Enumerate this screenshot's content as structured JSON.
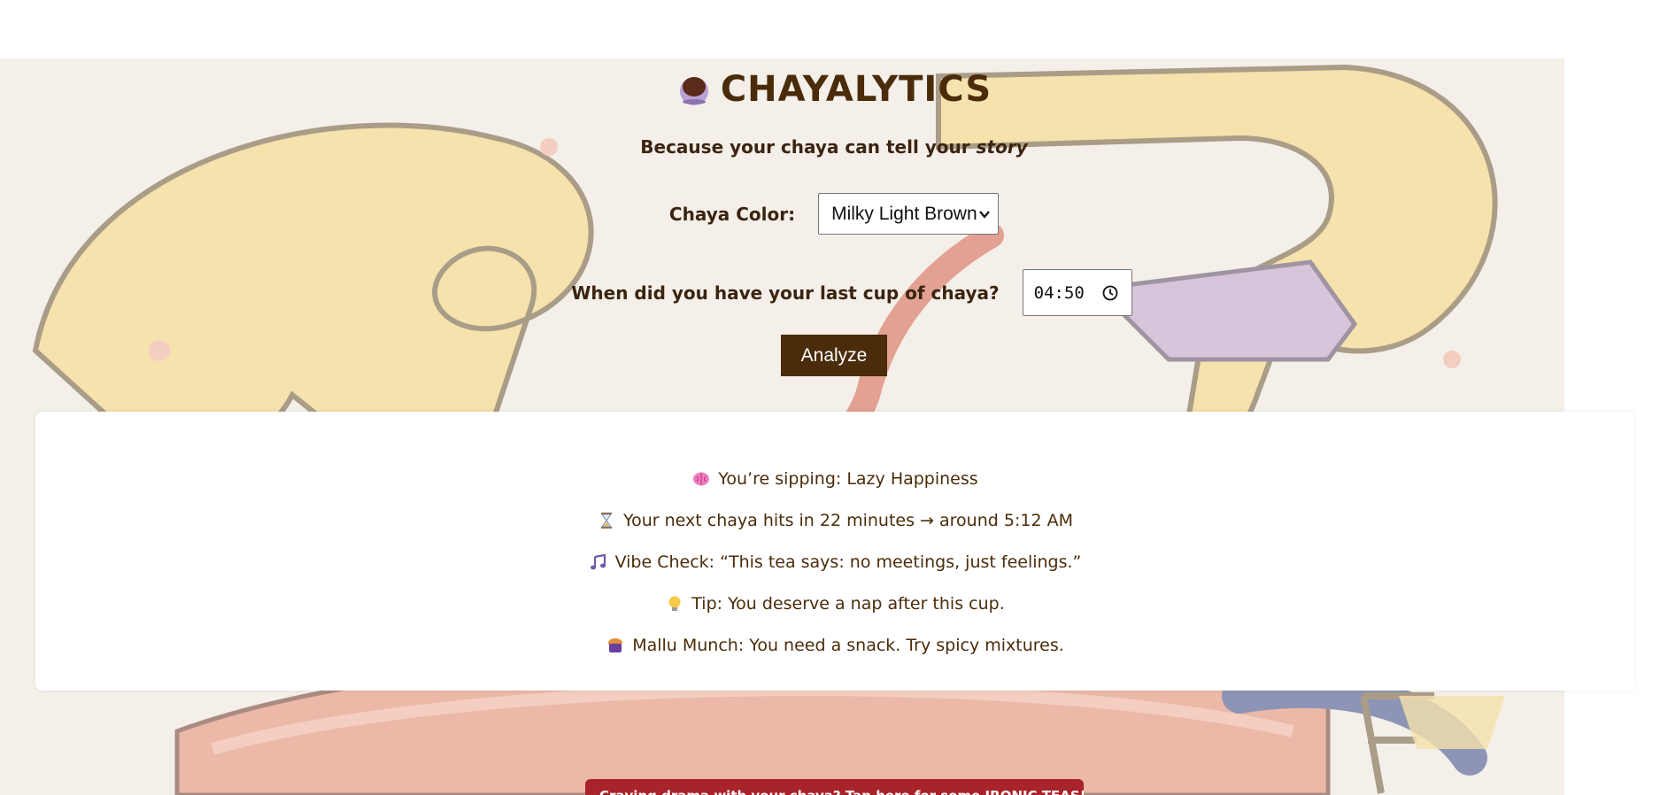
{
  "app": {
    "title": "CHAYALYTICS",
    "subtitle_prefix": "Because your chaya can tell your ",
    "subtitle_emphasis": "story"
  },
  "form": {
    "color_label": "Chaya Color:",
    "color_selected": "Milky Light Brown",
    "time_label": "When did you have your last cup of chaya?",
    "time_value": "04:50",
    "analyze_label": "Analyze"
  },
  "results": [
    {
      "icon": "brain-icon",
      "text": "You’re sipping: Lazy Happiness"
    },
    {
      "icon": "hourglass-icon",
      "text": "Your next chaya hits in 22 minutes → around 5:12 AM"
    },
    {
      "icon": "music-note-icon",
      "text": "Vibe Check: “This tea says: no meetings, just feelings.”"
    },
    {
      "icon": "lightbulb-icon",
      "text": "Tip: You deserve a nap after this cup."
    },
    {
      "icon": "snack-icon",
      "text": "Mallu Munch: You need a snack. Try spicy mixtures."
    }
  ],
  "promo": {
    "text": "Craving drama with your chaya? Tap here for some IRONIC TEAS! ☕"
  },
  "colors": {
    "brand_brown": "#4a2c0a",
    "promo_red": "#a8232a"
  }
}
